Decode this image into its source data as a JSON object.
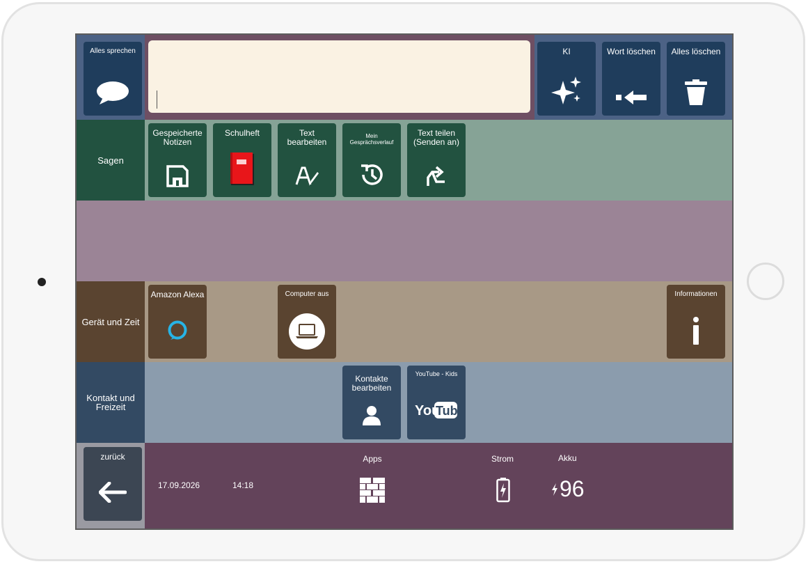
{
  "top": {
    "speak_all_label": "Alles sprechen",
    "message_text": "",
    "ki_label": "KI",
    "delete_word_label": "Wort löschen",
    "delete_all_label": "Alles löschen"
  },
  "sagen": {
    "category_label": "Sagen",
    "tiles": [
      {
        "label": "Gespeicherte Notizen",
        "icon": "floppy-disk-icon"
      },
      {
        "label": "Schulheft",
        "icon": "red-notebook-icon"
      },
      {
        "label": "Text bearbeiten",
        "icon": "edit-text-icon"
      },
      {
        "label": "Mein Gesprächsverlauf",
        "icon": "history-icon"
      },
      {
        "label": "Text teilen (Senden an)",
        "icon": "share-icon"
      }
    ]
  },
  "geraet": {
    "category_label": "Gerät und Zeit",
    "tiles": [
      {
        "label": "Amazon Alexa",
        "icon": "alexa-icon"
      },
      {
        "label": "Computer aus",
        "icon": "laptop-icon"
      },
      {
        "label": "Informationen",
        "icon": "info-icon"
      }
    ]
  },
  "kontakt": {
    "category_label": "Kontakt und Freizeit",
    "tiles": [
      {
        "label": "Kontakte bearbeiten",
        "icon": "person-icon"
      },
      {
        "label": "YouTube - Kids",
        "icon": "youtube-icon"
      }
    ]
  },
  "bottom": {
    "back_label": "zurück",
    "date": "17.09.2026",
    "time": "14:18",
    "apps_label": "Apps",
    "power_label": "Strom",
    "battery_label": "Akku",
    "battery_value": "96"
  },
  "colors": {
    "top_bar": "#6e4f63",
    "top_tiles": "#1f3d5c",
    "sagen_row": "#86a396",
    "sagen_dark": "#225240",
    "empty_row": "#9b8496",
    "geraet_row": "#a89986",
    "geraet_dark": "#5a4430",
    "kontakt_row": "#8b9cad",
    "kontakt_dark": "#334a63",
    "bottom_bar": "#63435a",
    "back_tile": "#3c4653"
  }
}
